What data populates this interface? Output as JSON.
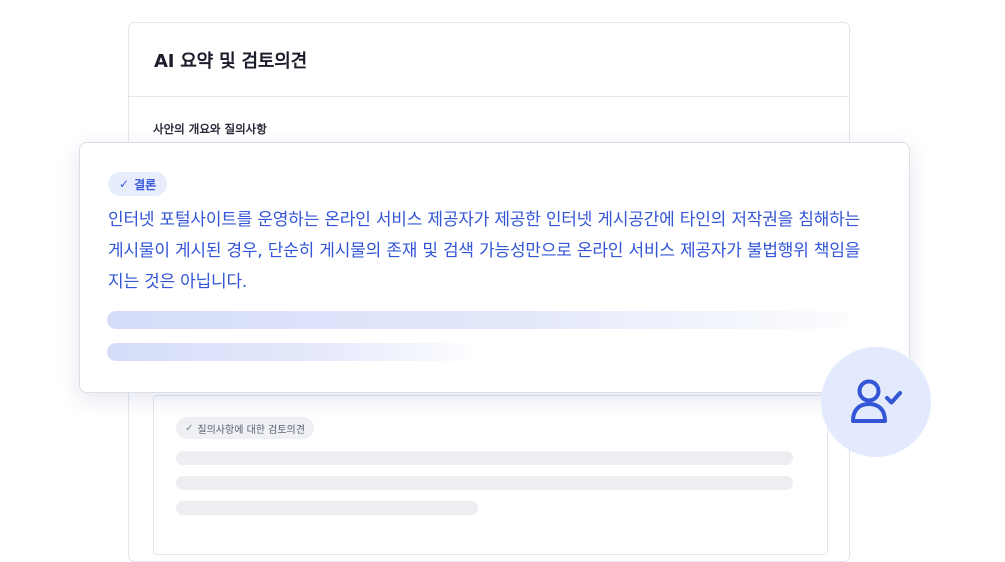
{
  "review_card": {
    "title": "AI 요약 및 검토의견",
    "section_label": "사안의 개요와 질의사항",
    "opinion_chip_label": "질의사항에 대한 검토의견"
  },
  "conclusion_card": {
    "chip_label": "결론",
    "text": "인터넷 포털사이트를 운영하는 온라인 서비스 제공자가 제공한 인터넷 게시공간에 타인의 저작권을 침해하는 게시물이 게시된 경우, 단순히 게시물의 존재 및 검색 가능성만으로 온라인 서비스 제공자가 불법행위 책임을 지는 것은 아닙니다."
  },
  "icons": {
    "check": "check-icon",
    "avatar": "user-check-icon"
  },
  "colors": {
    "accent": "#3355d6",
    "chip_bg": "#e8edfd",
    "avatar_bg": "#e4eafd"
  }
}
